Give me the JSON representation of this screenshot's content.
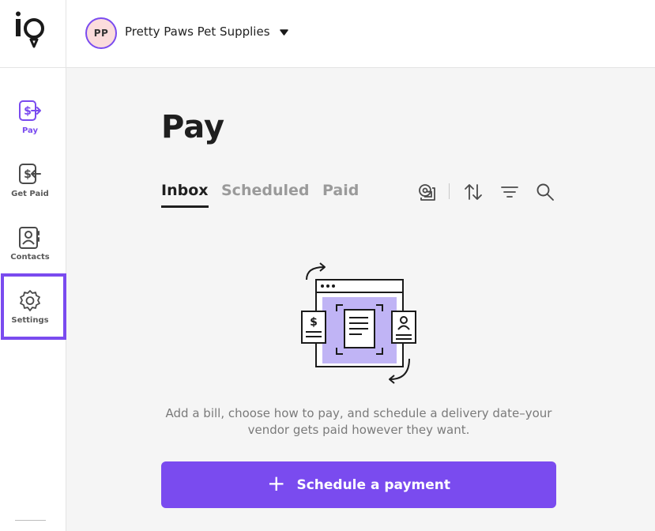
{
  "brand": {
    "logo_icon": "io-logo",
    "accent": "#7a4bef"
  },
  "header": {
    "org_initials": "PP",
    "org_name": "Pretty Paws Pet Supplies",
    "org_caret_icon": "caret-down-icon",
    "avatar_color": "#fbdcdc"
  },
  "sidebar": {
    "items": [
      {
        "label": "Pay",
        "icon": "pay-dollar-out-icon",
        "active": true
      },
      {
        "label": "Get Paid",
        "icon": "get-paid-dollar-in-icon",
        "active": false
      },
      {
        "label": "Contacts",
        "icon": "contacts-book-icon",
        "active": false
      },
      {
        "label": "Settings",
        "icon": "gear-icon",
        "active": false
      }
    ]
  },
  "annotation": {
    "highlight_target": "Settings",
    "arrow_icon": "left-arrow-icon",
    "color": "#7a4bef"
  },
  "main": {
    "title": "Pay",
    "tabs": [
      {
        "label": "Inbox",
        "active": true
      },
      {
        "label": "Scheduled",
        "active": false
      },
      {
        "label": "Paid",
        "active": false
      }
    ],
    "toolbar": [
      "email-bills-icon",
      "sort-icon",
      "filter-icon",
      "search-icon"
    ],
    "empty_state": {
      "illustration": "bills-documents-illustration",
      "text": "Add a bill, choose how to pay, and schedule a delivery date–your vendor gets paid however they want."
    },
    "cta": {
      "plus": "+",
      "label": "Schedule a payment"
    }
  }
}
